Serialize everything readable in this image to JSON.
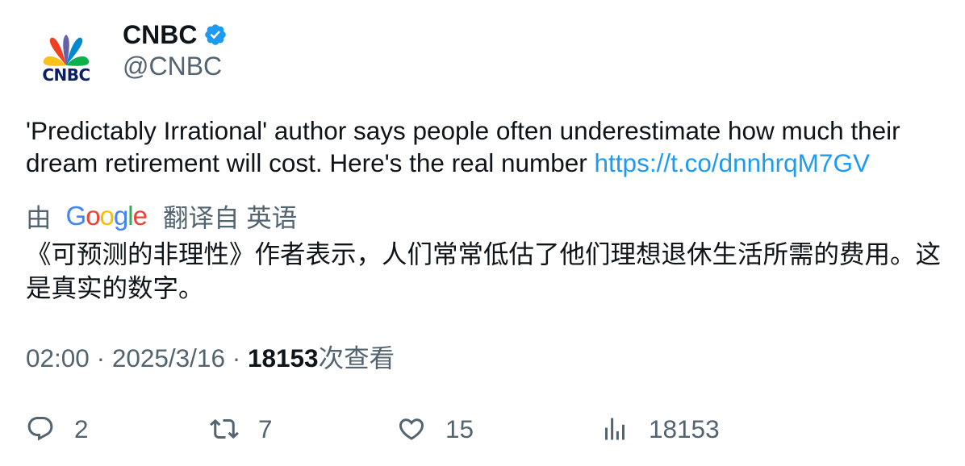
{
  "account": {
    "display_name": "CNBC",
    "handle": "@CNBC",
    "avatar_logo_text": "CNBC",
    "verified": true
  },
  "tweet": {
    "text": "'Predictably Irrational' author says people often underestimate how much their dream retirement will cost. Here's the real number ",
    "link": "https://t.co/dnnhrqM7GV"
  },
  "translation": {
    "by_label": "由",
    "provider": "Google",
    "translated_from_label": "翻译自 英语",
    "text": "《可预测的非理性》作者表示，人们常常低估了他们理想退休生活所需的费用。这是真实的数字。"
  },
  "meta": {
    "time": "02:00",
    "separator": " · ",
    "date": "2025/3/16",
    "views_count": "18153",
    "views_label": "次查看"
  },
  "actions": {
    "replies": "2",
    "retweets": "7",
    "likes": "15",
    "views": "18153"
  },
  "colors": {
    "text": "#0f1419",
    "secondary": "#536471",
    "link": "#1d9bf0",
    "verified": "#1d9bf0"
  }
}
